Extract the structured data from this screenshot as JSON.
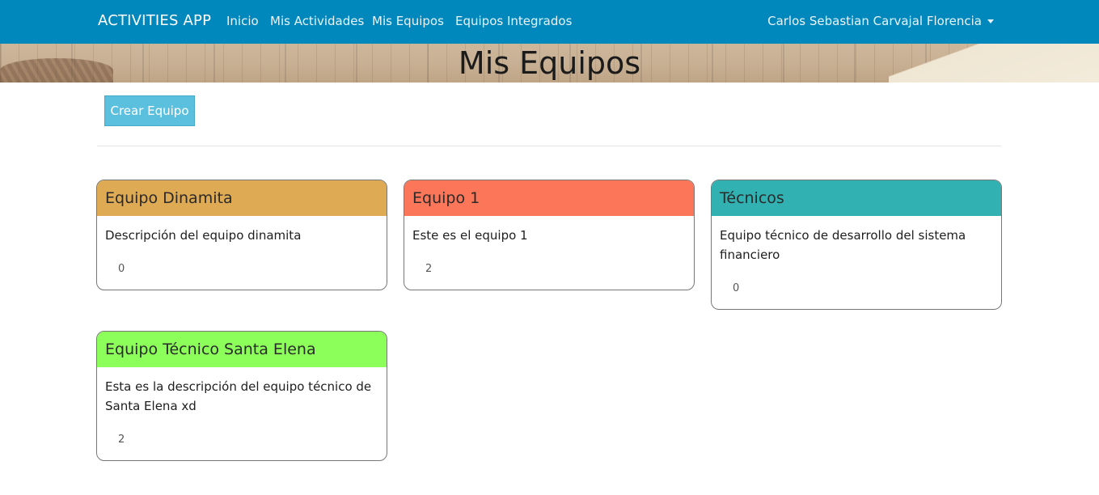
{
  "navbar": {
    "brand": "ACTIVITIES APP",
    "links": [
      "Inicio",
      "Mis Actividades",
      "Mis Equipos",
      "Equipos Integrados"
    ],
    "user": "Carlos Sebastian Carvajal Florencia",
    "user_icon": "caret-down-icon"
  },
  "page": {
    "title": "Mis Equipos",
    "create_button": "Crear Equipo"
  },
  "teams": [
    {
      "name": "Equipo Dinamita",
      "description": "Descripción del equipo dinamita",
      "count": "0",
      "color": "#deaa53"
    },
    {
      "name": "Equipo 1",
      "description": "Este es el equipo 1",
      "count": "2",
      "color": "#fc765a"
    },
    {
      "name": "Técnicos",
      "description": "Equipo técnico de desarrollo del sistema financiero",
      "count": "0",
      "color": "#31b1b1"
    },
    {
      "name": "Equipo Técnico Santa Elena",
      "description": "Esta es la descripción del equipo técnico de Santa Elena xd",
      "count": "2",
      "color": "#8dff5a"
    }
  ],
  "colors": {
    "navbar": "#0088bd",
    "create_button": "#5bc0de"
  }
}
